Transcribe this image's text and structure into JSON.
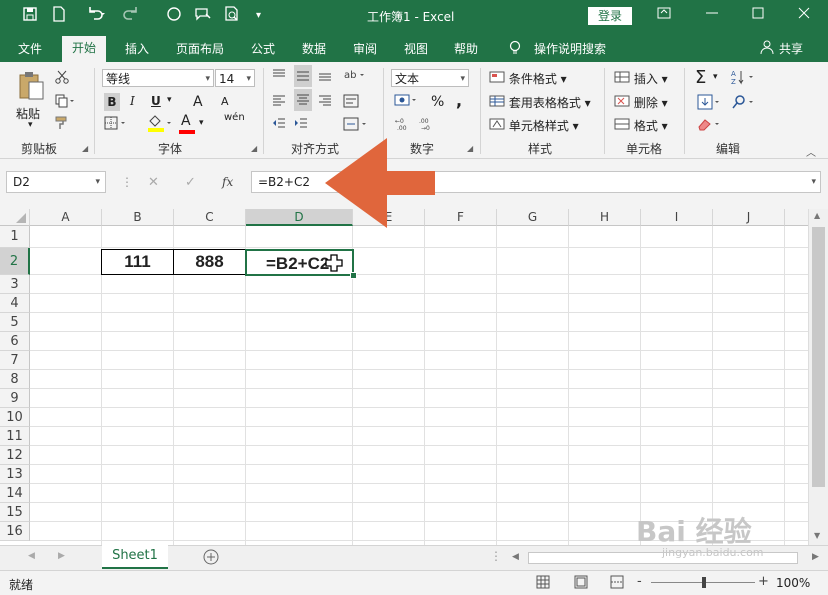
{
  "titlebar": {
    "title": "工作簿1  -  Excel",
    "login": "登录",
    "icons": [
      "save-icon",
      "new-file-icon",
      "undo-icon",
      "redo-icon",
      "circle-icon",
      "touch-icon",
      "print-preview-icon",
      "customize-icon"
    ]
  },
  "tabs": [
    "文件",
    "开始",
    "插入",
    "页面布局",
    "公式",
    "数据",
    "审阅",
    "视图",
    "帮助"
  ],
  "tell_me": "操作说明搜索",
  "share": "共享",
  "ribbon": {
    "clipboard": {
      "paste": "粘贴",
      "label": "剪贴板"
    },
    "font": {
      "name": "等线",
      "size": "14",
      "label": "字体",
      "bold": "B",
      "italic": "I",
      "underline": "U",
      "grow": "A",
      "shrink": "A",
      "color": "A",
      "wen": "wén"
    },
    "alignment": {
      "label": "对齐方式"
    },
    "number": {
      "format": "文本",
      "label": "数字",
      "percent": "%",
      "comma": ","
    },
    "styles": {
      "conditional": "条件格式",
      "table": "套用表格格式",
      "cell": "单元格样式",
      "label": "样式"
    },
    "cells": {
      "insert": "插入",
      "delete": "删除",
      "format": "格式",
      "label": "单元格"
    },
    "editing": {
      "label": "编辑"
    }
  },
  "formula_bar": {
    "name_box": "D2",
    "formula": "=B2+C2",
    "fx": "fx"
  },
  "columns": [
    "A",
    "B",
    "C",
    "D",
    "E",
    "F",
    "G",
    "H",
    "I",
    "J"
  ],
  "rows": [
    "1",
    "2",
    "3",
    "4",
    "5",
    "6",
    "7",
    "8",
    "9",
    "10",
    "11",
    "12",
    "13",
    "14",
    "15",
    "16"
  ],
  "selected_column": "D",
  "selected_row": "2",
  "cells": {
    "B2": "111",
    "C2": "888",
    "D2": "=B2+C2"
  },
  "sheet_tab": "Sheet1",
  "status": {
    "ready": "就绪",
    "zoom": "100%",
    "minus": "-",
    "plus": "+"
  },
  "watermark": {
    "brand": "Bai 经验",
    "url": "jingyan.baidu.com"
  },
  "colors": {
    "excel_green": "#217346",
    "arrow": "#e0663c"
  }
}
